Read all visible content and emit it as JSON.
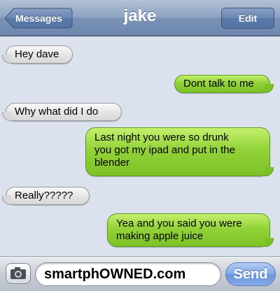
{
  "navbar": {
    "title": "jake",
    "back_label": "Messages",
    "edit_label": "Edit"
  },
  "messages": [
    {
      "side": "received",
      "lines": [
        "Hey dave"
      ]
    },
    {
      "side": "sent",
      "lines": [
        "Dont talk to me"
      ]
    },
    {
      "side": "received",
      "lines": [
        "Why what did I do"
      ]
    },
    {
      "side": "sent",
      "lines": [
        "Last night you were so drunk",
        "you got my ipad and put in the",
        "blender"
      ]
    },
    {
      "side": "received",
      "lines": [
        "Really?????"
      ]
    },
    {
      "side": "sent",
      "lines": [
        "Yea and you said you were",
        "making apple juice"
      ]
    }
  ],
  "input": {
    "value": "smartphOWNED.com",
    "send_label": "Send",
    "camera_icon": "camera-icon"
  }
}
